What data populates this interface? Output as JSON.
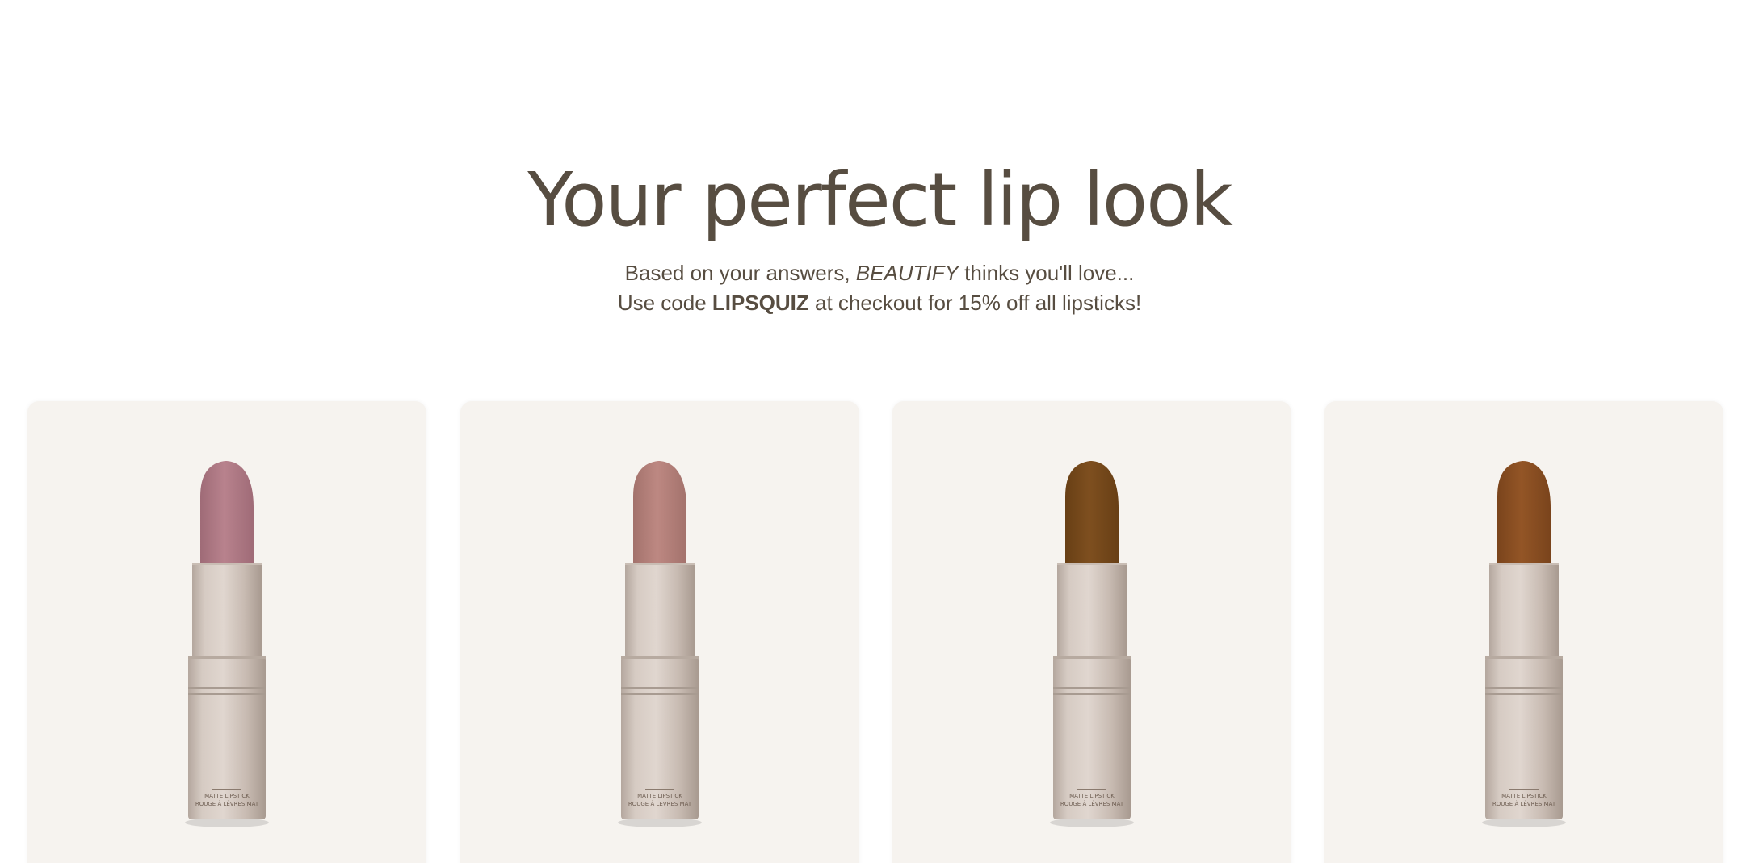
{
  "hero": {
    "title": "Your perfect lip look",
    "line1_pre": "Based on your answers, ",
    "line1_brand": "BEAUTIFY",
    "line1_post": " thinks you'll love...",
    "line2_pre": "Use code ",
    "line2_code": "LIPSQUIZ",
    "line2_post": " at checkout for 15% off all lipsticks!"
  },
  "products": [
    {
      "name": "product-card-mauve",
      "bullet_color": "#b8828d",
      "bullet_shade": "#9f6b77",
      "label_line1": "MATTE LIPSTICK",
      "label_line2": "ROUGE À LÈVRES MAT"
    },
    {
      "name": "product-card-rose-nude",
      "bullet_color": "#bd8882",
      "bullet_shade": "#a3726c",
      "label_line1": "MATTE LIPSTICK",
      "label_line2": "ROUGE À LÈVRES MAT"
    },
    {
      "name": "product-card-brown",
      "bullet_color": "#7e4f1f",
      "bullet_shade": "#683f15",
      "label_line1": "MATTE LIPSTICK",
      "label_line2": "ROUGE À LÈVRES MAT"
    },
    {
      "name": "product-card-cinnamon",
      "bullet_color": "#935526",
      "bullet_shade": "#7a441c",
      "label_line1": "MATTE LIPSTICK",
      "label_line2": "ROUGE À LÈVRES MAT"
    }
  ]
}
